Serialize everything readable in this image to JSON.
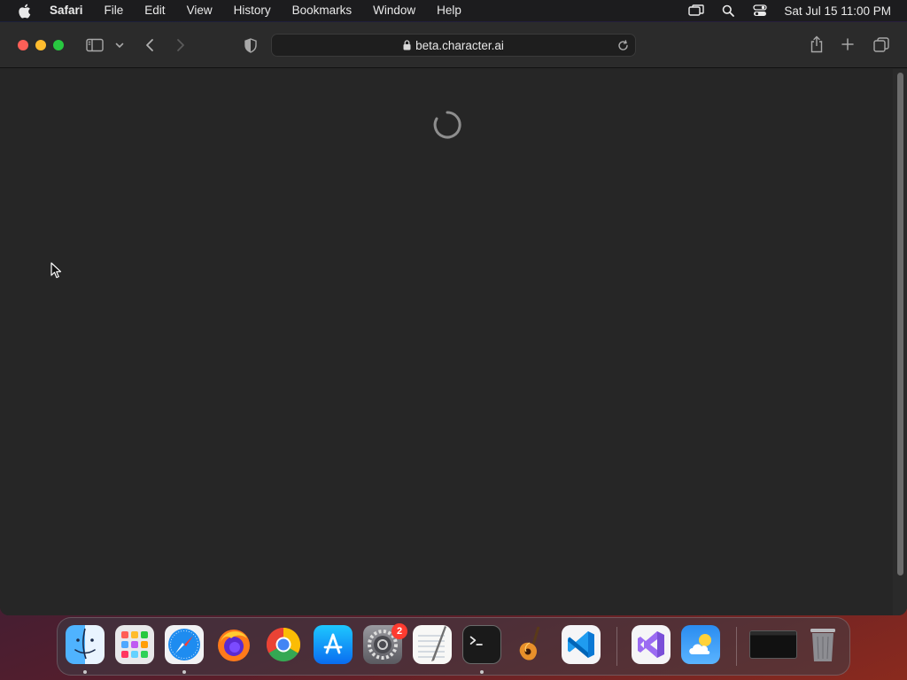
{
  "menubar": {
    "app_name": "Safari",
    "items": [
      "File",
      "Edit",
      "View",
      "History",
      "Bookmarks",
      "Window",
      "Help"
    ],
    "clock": "Sat Jul 15  11:00 PM"
  },
  "browser": {
    "url": "beta.character.ai",
    "page_state": "loading"
  },
  "dock": {
    "apps": [
      "Finder",
      "Launchpad",
      "Safari",
      "Firefox",
      "Google Chrome",
      "App Store",
      "System Settings",
      "TextEdit",
      "Terminal",
      "GarageBand",
      "Visual Studio Code",
      "Visual Studio",
      "Weather",
      "Window Preview",
      "Trash"
    ],
    "system_settings_badge": "2"
  },
  "colors": {
    "close": "#ff5f57",
    "minimize": "#febc2e",
    "maximize": "#28c840",
    "badge": "#ff3b30"
  }
}
